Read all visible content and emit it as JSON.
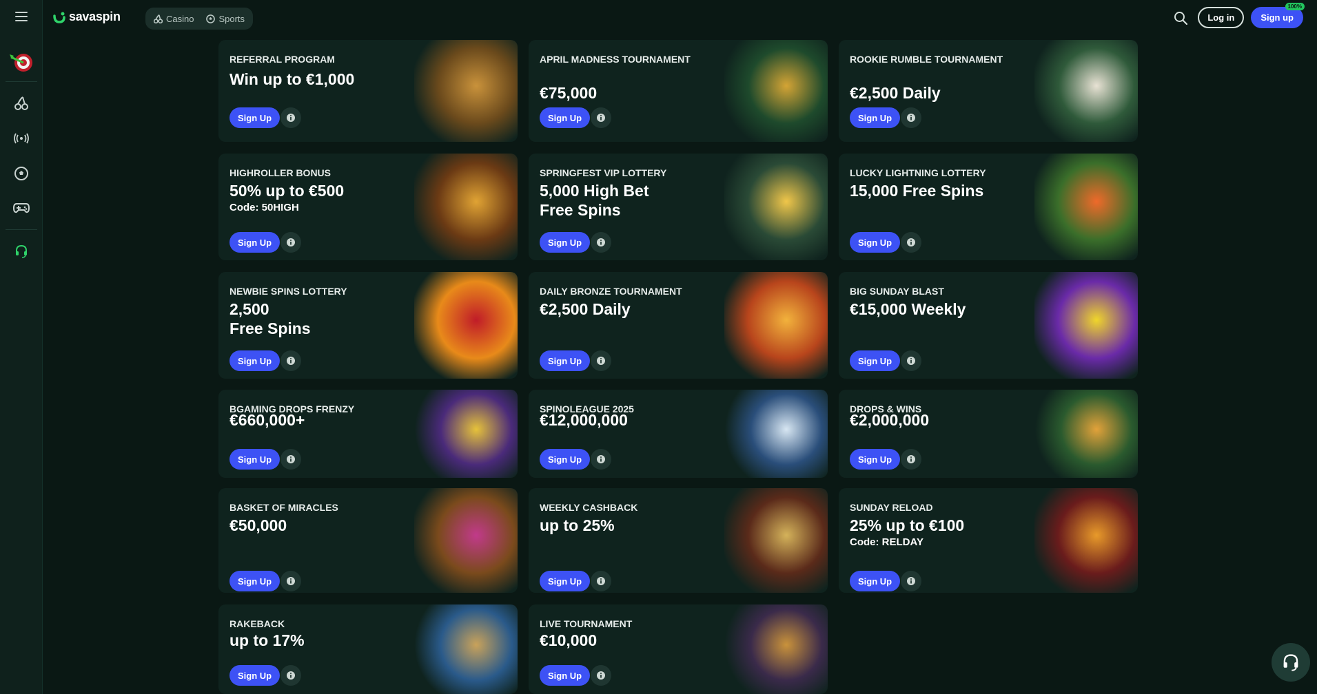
{
  "header": {
    "logo_text": "savaspin",
    "modes": [
      {
        "label": "Casino",
        "icon": "cherries-icon"
      },
      {
        "label": "Sports",
        "icon": "soccer-ball-icon"
      }
    ],
    "login_label": "Log in",
    "signup_label": "Sign up",
    "signup_badge": "100%"
  },
  "sidebar": {
    "items": [
      {
        "name": "menu-icon"
      },
      {
        "name": "target-dart-icon"
      },
      {
        "name": "cherries-icon"
      },
      {
        "name": "live-broadcast-icon"
      },
      {
        "name": "soccer-ball-icon"
      },
      {
        "name": "gamepad-icon"
      },
      {
        "name": "headset-icon"
      }
    ]
  },
  "promos": [
    {
      "kicker": "REFERRAL PROGRAM",
      "headline": "Win up to €1,000",
      "code": "",
      "cta": "Sign Up",
      "art": "owl",
      "colors": [
        "#6b4a1c",
        "#c9923b"
      ]
    },
    {
      "kicker": "APRIL MADNESS TOURNAMENT",
      "headline": "€75,000",
      "code": "",
      "cta": "Sign Up",
      "art": "elf-king",
      "colors": [
        "#1e4a2c",
        "#d4a435"
      ]
    },
    {
      "kicker": "ROOKIE RUMBLE TOURNAMENT",
      "headline": "€2,500 Daily",
      "code": "",
      "cta": "Sign Up",
      "art": "zeus",
      "colors": [
        "#2f5a3a",
        "#e8e2d4"
      ]
    },
    {
      "kicker": "HIGHROLLER BONUS",
      "headline": "50% up to €500",
      "code": "Code: 50HIGH",
      "cta": "Sign Up",
      "art": "king-treasure",
      "colors": [
        "#6b3a14",
        "#e0a334"
      ]
    },
    {
      "kicker": "SPRINGFEST VIP LOTTERY",
      "headline": "5,000 High Bet\nFree Spins",
      "code": "",
      "cta": "Sign Up",
      "art": "vip-girl",
      "colors": [
        "#2a4a36",
        "#f0c64a"
      ]
    },
    {
      "kicker": "LUCKY LIGHTNING LOTTERY",
      "headline": "15,000 Free Spins",
      "code": "",
      "cta": "Sign Up",
      "art": "parrot-fs",
      "colors": [
        "#3a6e2a",
        "#ef6a2a"
      ]
    },
    {
      "kicker": "NEWBIE SPINS LOTTERY",
      "headline": "2,500\nFree Spins",
      "code": "",
      "cta": "Sign Up",
      "art": "fruits",
      "colors": [
        "#e88a1a",
        "#c01c28"
      ]
    },
    {
      "kicker": "DAILY BRONZE TOURNAMENT",
      "headline": "€2,500 Daily",
      "code": "",
      "cta": "Sign Up",
      "art": "red-haired-girl",
      "colors": [
        "#b8451c",
        "#f2b23c"
      ]
    },
    {
      "kicker": "BIG SUNDAY BLAST",
      "headline": "€15,000 Weekly",
      "code": "",
      "cta": "Sign Up",
      "art": "multipliers",
      "colors": [
        "#6a2aa8",
        "#f0d62a"
      ]
    },
    {
      "kicker": "BGAMING DROPS FRENZY",
      "headline": "€660,000+",
      "code": "",
      "cta": "Sign Up",
      "art": "rabbit",
      "colors": [
        "#4a2a7a",
        "#e6c23a"
      ]
    },
    {
      "kicker": "SPINOLEAGUE 2025",
      "headline": "€12,000,000",
      "code": "",
      "cta": "Sign Up",
      "art": "wizard",
      "colors": [
        "#2a4e7a",
        "#d7e6f2"
      ]
    },
    {
      "kicker": "DROPS & WINS",
      "headline": "€2,000,000",
      "code": "",
      "cta": "Sign Up",
      "art": "adventurer",
      "colors": [
        "#2a5a2e",
        "#e2a23a"
      ]
    },
    {
      "kicker": "BASKET OF MIRACLES",
      "headline": "€50,000",
      "code": "",
      "cta": "Sign Up",
      "art": "easter-basket",
      "colors": [
        "#7a4a1c",
        "#c13a8a"
      ]
    },
    {
      "kicker": "WEEKLY CASHBACK",
      "headline": "up to 25%",
      "code": "",
      "cta": "Sign Up",
      "art": "cashback-pot",
      "colors": [
        "#5a2a1a",
        "#d4b25a"
      ]
    },
    {
      "kicker": "SUNDAY RELOAD",
      "headline": "25% up to €100",
      "code": "Code: RELDAY",
      "cta": "Sign Up",
      "art": "trophy",
      "colors": [
        "#6a1c1c",
        "#e89a2a"
      ]
    },
    {
      "kicker": "RAKEBACK",
      "headline": "up to 17%",
      "code": "",
      "cta": "Sign Up",
      "art": "rakeback-pillar",
      "colors": [
        "#2a5a8a",
        "#c9a25a"
      ]
    },
    {
      "kicker": "LIVE TOURNAMENT",
      "headline": "€10,000",
      "code": "",
      "cta": "Sign Up",
      "art": "roulette",
      "colors": [
        "#3a2a4a",
        "#c9923b"
      ]
    }
  ]
}
